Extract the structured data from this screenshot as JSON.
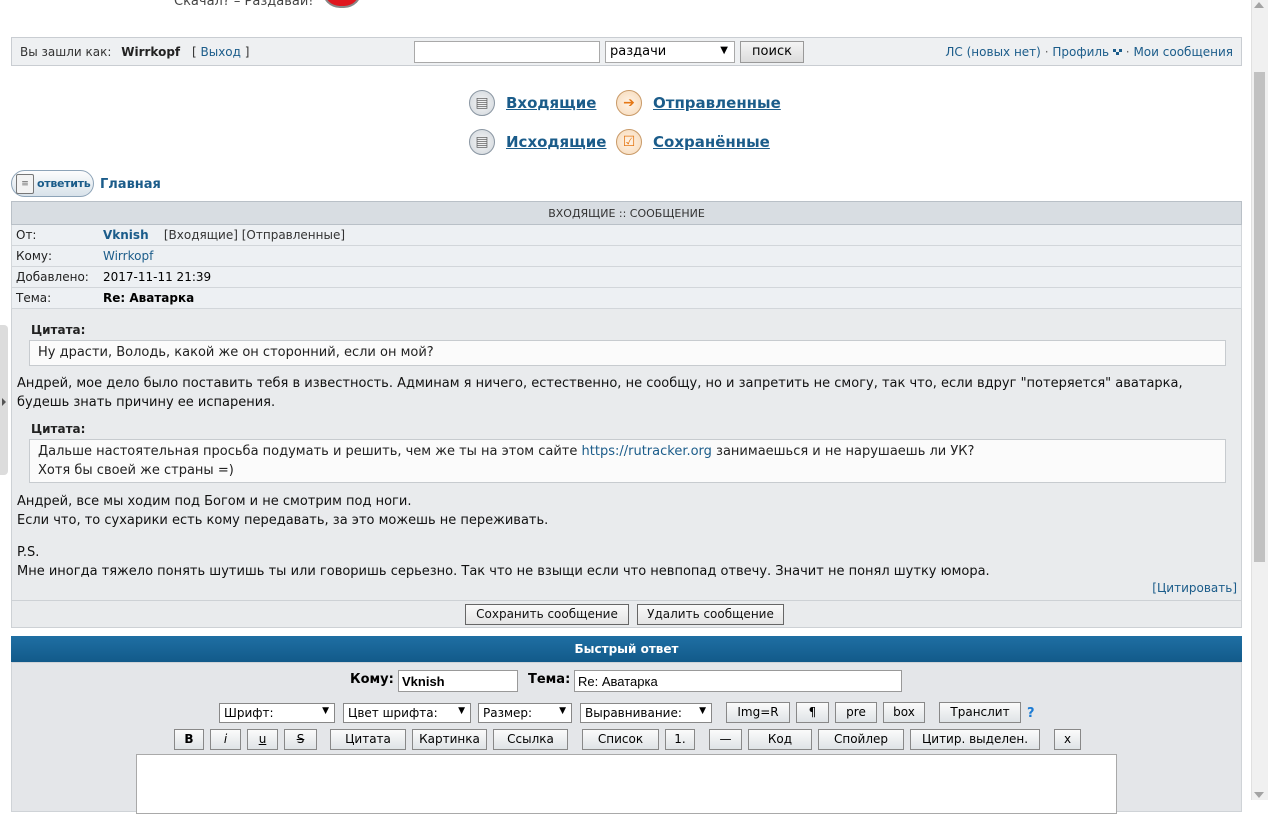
{
  "top": {
    "slogan": "Скачал? – Раздавай!"
  },
  "login_bar": {
    "logged_in_as": "Вы зашли как:",
    "username": "Wirrkopf",
    "bracket_open": "[",
    "logout": "Выход",
    "bracket_close": "]",
    "search_value": "",
    "search_scope": "раздачи",
    "search_button": "поиск",
    "pm_link": "ЛС (новых нет)",
    "sep1": "·",
    "profile_link": "Профиль",
    "sep2": "·",
    "my_messages_link": "Мои сообщения"
  },
  "pm_nav": {
    "inbox": "Входящие",
    "sent": "Отправленные",
    "outbox": "Исходящие",
    "saved": "Сохранённые"
  },
  "reply_row": {
    "reply_button": "ответить",
    "home_link": "Главная"
  },
  "message": {
    "header": "ВХОДЯЩИЕ :: СООБЩЕНИЕ",
    "from_label": "От:",
    "from_user": "Vknish",
    "from_inbox_link": "[Входящие]",
    "from_sent_link": "[Отправленные]",
    "to_label": "Кому:",
    "to_user": "Wirrkopf",
    "added_label": "Добавлено:",
    "added_value": "2017-11-11 21:39",
    "subject_label": "Тема:",
    "subject_value": "Re: Аватарка",
    "quote1_title": "Цитата:",
    "quote1_text": "Ну драсти, Володь, какой же он сторонний, если он мой?",
    "para1": "Андрей, мое дело было поставить тебя в известность. Админам я ничего, естественно, не сообщу, но и запретить не смогу, так что, если вдруг \"потеряется\" аватарка, будешь знать причину ее испарения.",
    "quote2_title": "Цитата:",
    "quote2_line1_pre": "Дальше настоятельная просьба подумать и решить, чем же ты на этом сайте ",
    "quote2_link": "https://rutracker.org",
    "quote2_line1_post": " занимаешься и не нарушаешь ли УК?",
    "quote2_line2": "Хотя бы своей же страны =)",
    "para2_line1": "Андрей, все мы ходим под Богом и не смотрим под ноги.",
    "para2_line2": "Если что, то сухарики есть кому передавать, за это можешь не переживать.",
    "ps": "P.S.",
    "ps_text": "Мне иногда тяжело понять шутишь ты или говоришь серьезно. Так что не взыщи если что невпопад отвечу. Значит не понял шутку юмора.",
    "cite_link": "[Цитировать]",
    "save_button": "Сохранить сообщение",
    "delete_button": "Удалить сообщение"
  },
  "quick_reply": {
    "title": "Быстрый ответ",
    "to_label": "Кому:",
    "to_value": "Vknish",
    "subject_label": "Тема:",
    "subject_value": "Re: Аватарка",
    "font_select": "Шрифт:",
    "color_select": "Цвет шрифта:",
    "size_select": "Размер:",
    "align_select": "Выравнивание:",
    "img_r": "Img=R",
    "para": "¶",
    "pre": "pre",
    "box": "box",
    "translit": "Транслит",
    "help": "?",
    "bold": "B",
    "italic": "i",
    "underline": "u",
    "strike": "S",
    "quote": "Цитата",
    "image": "Картинка",
    "link": "Ссылка",
    "list": "Список",
    "list_num": "1.",
    "hr": "—",
    "code": "Код",
    "spoiler": "Спойлер",
    "quote_selected": "Цитир. выделен.",
    "close": "x"
  },
  "colors": {
    "link": "#1b5c8a",
    "qr_header": "#1a659a",
    "panel_bg": "#e9ebed"
  }
}
